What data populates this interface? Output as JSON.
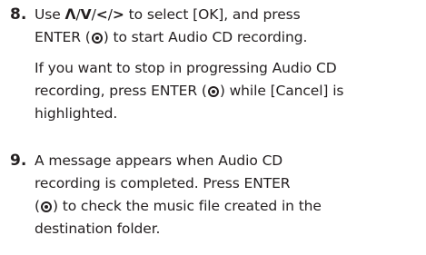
{
  "steps": [
    {
      "number": "8.",
      "paragraphs": [
        {
          "lines": [
            {
              "pre": "Use ",
              "arrow_up": "Λ",
              "sep1": "/",
              "arrow_down": "V",
              "sep2": "/",
              "arrow_left": "<",
              "sep3": "/",
              "arrow_right": ">",
              "post": " to select [OK], and press"
            },
            {
              "pre": "ENTER (",
              "post": ") to start Audio CD recording."
            }
          ]
        },
        {
          "lines": [
            {
              "text": "If you want to stop in progressing Audio CD"
            },
            {
              "pre": "recording, press ENTER (",
              "post": ") while [Cancel] is"
            },
            {
              "text": "highlighted."
            }
          ]
        }
      ]
    },
    {
      "number": "9.",
      "paragraphs": [
        {
          "lines": [
            {
              "text": "A message appears when Audio CD"
            },
            {
              "text": "recording is completed. Press ENTER"
            },
            {
              "pre": "(",
              "post": ") to check the music file created in the"
            },
            {
              "text": "destination folder."
            }
          ]
        }
      ]
    }
  ],
  "icons": {
    "enter": "enter-button-icon"
  }
}
